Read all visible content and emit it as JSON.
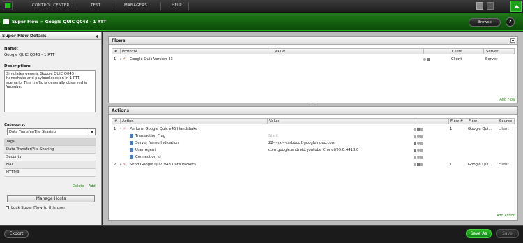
{
  "nav": {
    "items": [
      "CONTROL CENTER",
      "TEST",
      "MANAGERS",
      "HELP"
    ]
  },
  "header": {
    "crumb_parent": "Super Flow",
    "crumb_sep": "»",
    "crumb_current": "Google QUIC Q043 - 1 RTT",
    "browse_label": "Browse",
    "help_label": "?"
  },
  "left": {
    "title": "Super Flow Details",
    "name_label": "Name:",
    "name_value": "Google QUIC Q043 - 1 RTT",
    "desc_label": "Description:",
    "desc_value": "Simulates generic Google QUIC Q043 handshake and payload session in 1 RTT scenario. This traffic is generally observed in Youtube.",
    "category_label": "Category:",
    "category_value": "Data Transfer/File Sharing",
    "tags_header": "Tags",
    "tags": [
      "Data Transfer/File Sharing",
      "Security",
      "NAT",
      "HTTP/3"
    ],
    "delete_label": "Delete",
    "add_label": "Add",
    "manage_hosts": "Manage Hosts",
    "lock_label": "Lock Super Flow to this user"
  },
  "flows": {
    "title": "Flows",
    "columns": [
      "#",
      "Protocol",
      "Value",
      "Client",
      "Server"
    ],
    "rows": [
      {
        "num": "1",
        "protocol": "Google Quic Version 43",
        "client": "Client",
        "server": "Server"
      }
    ],
    "add_label": "Add Flow"
  },
  "actions": {
    "title": "Actions",
    "columns": [
      "#",
      "Action",
      "Value",
      "Flow #",
      "Flow",
      "Source"
    ],
    "rows": [
      {
        "num": "1",
        "action": "Perform Google Quic v43 Handshake",
        "value": "",
        "flownum": "1",
        "flow": "Google Qui...",
        "source": "client"
      },
      {
        "num": "",
        "action": "Transaction Flag",
        "value": "Start",
        "flownum": "",
        "flow": "",
        "source": ""
      },
      {
        "num": "",
        "action": "Server Name Indication",
        "value": "22---xx---cssbbcc2.googlevideo.com",
        "flownum": "",
        "flow": "",
        "source": ""
      },
      {
        "num": "",
        "action": "User Agent",
        "value": "com.google.android.youtube Cronet/99.0.4413.0",
        "flownum": "",
        "flow": "",
        "source": ""
      },
      {
        "num": "",
        "action": "Connection Id",
        "value": "",
        "flownum": "",
        "flow": "",
        "source": ""
      },
      {
        "num": "2",
        "action": "Send Google Quic v43 Data Packets",
        "value": "",
        "flownum": "1",
        "flow": "Google Qui...",
        "source": "client"
      }
    ],
    "add_label": "Add Action"
  },
  "footer": {
    "export": "Export",
    "save_as": "Save As",
    "save": "Save"
  },
  "colors": {
    "accent": "#1d8a18",
    "brand_green": "#19c30f",
    "link": "#2a8a1a"
  }
}
